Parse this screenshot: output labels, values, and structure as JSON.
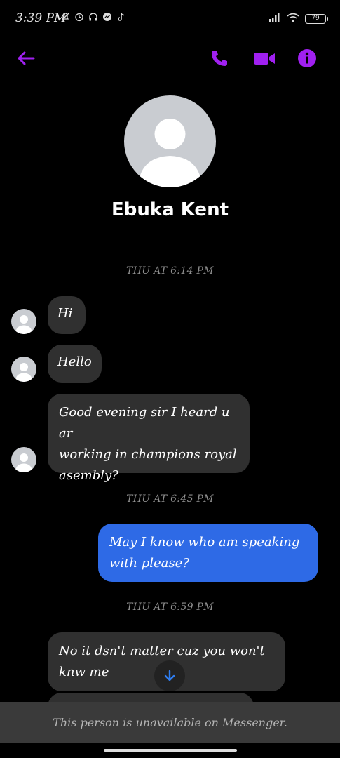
{
  "status_bar": {
    "time": "3:39 PM",
    "battery": "79"
  },
  "colors": {
    "accent": "#a020f0",
    "outgoing_bubble": "#2e6ae6",
    "incoming_bubble": "#303030",
    "background": "#000000"
  },
  "header": {
    "icons": [
      "back-arrow-icon",
      "phone-icon",
      "video-camera-icon",
      "info-icon"
    ]
  },
  "contact": {
    "name": "Ebuka Kent"
  },
  "conversation": {
    "timestamp_1": "THU AT 6:14 PM",
    "msg_1": "Hi",
    "msg_2": "Hello",
    "msg_3_line1": "Good evening sir I heard u ar",
    "msg_3_line2": "working in champions royal",
    "msg_3_line3": "asembly?",
    "timestamp_2": "THU AT 6:45 PM",
    "msg_4_line1": "May I know who am speaking",
    "msg_4_line2": "with please?",
    "timestamp_3": "THU AT 6:59 PM",
    "msg_5_line1": "No it dsn't matter cuz you won't",
    "msg_5_line2": "knw me"
  },
  "footer": {
    "unavailable_text": "This person is unavailable on Messenger."
  }
}
